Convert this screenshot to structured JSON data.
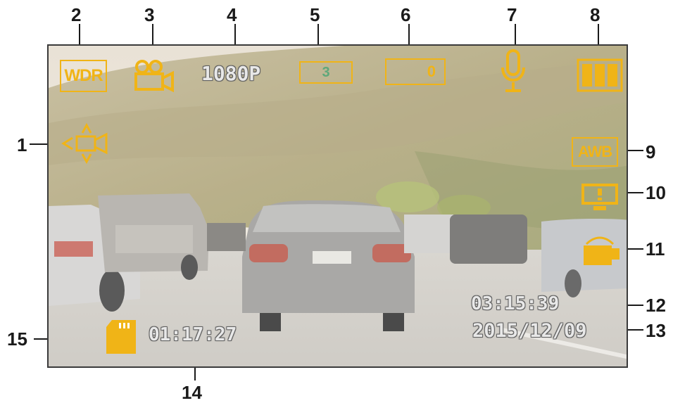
{
  "callouts": [
    "1",
    "2",
    "3",
    "4",
    "5",
    "6",
    "7",
    "8",
    "9",
    "10",
    "11",
    "12",
    "13",
    "14",
    "15"
  ],
  "osd": {
    "wdr": "WDR",
    "resolution": "1080P",
    "loop_value": "3",
    "exposure_value": "0",
    "awb": "AWB",
    "time": "03:15:39",
    "date": "2015/12/09",
    "record_time": "01:17:27"
  },
  "icons": [
    "motion-detection-icon",
    "wdr-icon",
    "video-camera-icon",
    "loop-recording-icon",
    "exposure-icon",
    "microphone-icon",
    "battery-icon",
    "awb-icon",
    "screen-saver-icon",
    "parking-mode-icon",
    "sd-card-icon"
  ],
  "colors": {
    "osd_amber": "#f0b417",
    "osd_text": "#e8e8e8",
    "callout": "#1a1a1a"
  }
}
